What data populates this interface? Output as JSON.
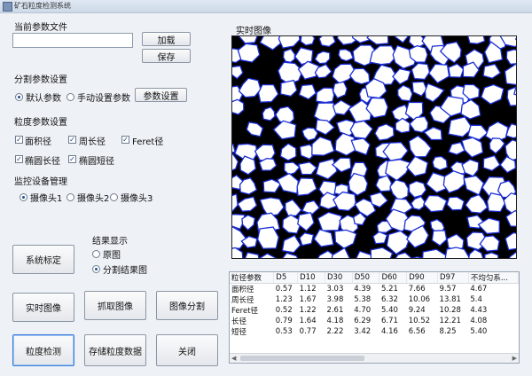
{
  "window": {
    "title": "矿石粒度检测系统"
  },
  "param_file": {
    "section": "当前参数文件",
    "path_value": "",
    "load_button": "加载",
    "save_button": "保存"
  },
  "segment": {
    "section": "分割参数设置",
    "default_option": "默认参数",
    "manual_option": "手动设置参数",
    "settings_button": "参数设置",
    "selected": "默认参数"
  },
  "granularity": {
    "section": "粒度参数设置",
    "options": [
      "面积径",
      "周长径",
      "Feret径",
      "椭圆长径",
      "椭圆短径"
    ]
  },
  "monitor": {
    "section": "监控设备管理",
    "cameras": [
      "摄像头1",
      "摄像头2",
      "摄像头3"
    ],
    "selected": "摄像头1"
  },
  "result_display": {
    "section": "结果显示",
    "original_option": "原图",
    "segmented_option": "分割结果图",
    "selected": "分割结果图"
  },
  "buttons": {
    "calibrate": "系统标定",
    "live_image": "实时图像",
    "capture_image": "抓取图像",
    "segment_image": "图像分割",
    "detect": "粒度检测",
    "store_data": "存储粒度数据",
    "close": "关闭"
  },
  "realtime": {
    "label": "实时图像"
  },
  "results_table": {
    "headers": [
      "粒径参数",
      "D5",
      "D10",
      "D30",
      "D50",
      "D60",
      "D90",
      "D97",
      "不均匀系..."
    ],
    "rows": [
      [
        "面积径",
        "0.57",
        "1.12",
        "3.03",
        "4.39",
        "5.21",
        "7.66",
        "9.57",
        "4.67"
      ],
      [
        "周长径",
        "1.23",
        "1.67",
        "3.98",
        "5.38",
        "6.32",
        "10.06",
        "13.81",
        "5.4"
      ],
      [
        "Feret径",
        "0.52",
        "1.22",
        "2.61",
        "4.70",
        "5.40",
        "9.24",
        "10.28",
        "4.43"
      ],
      [
        "长径",
        "0.79",
        "1.64",
        "4.18",
        "6.29",
        "6.71",
        "10.52",
        "12.21",
        "4.08"
      ],
      [
        "短径",
        "0.53",
        "0.77",
        "2.22",
        "3.42",
        "4.16",
        "6.56",
        "8.25",
        "5.40"
      ]
    ]
  },
  "colors": {
    "grain_outline": "#1b2fd6",
    "grain_fill": "#ffffff",
    "background": "#000000"
  }
}
